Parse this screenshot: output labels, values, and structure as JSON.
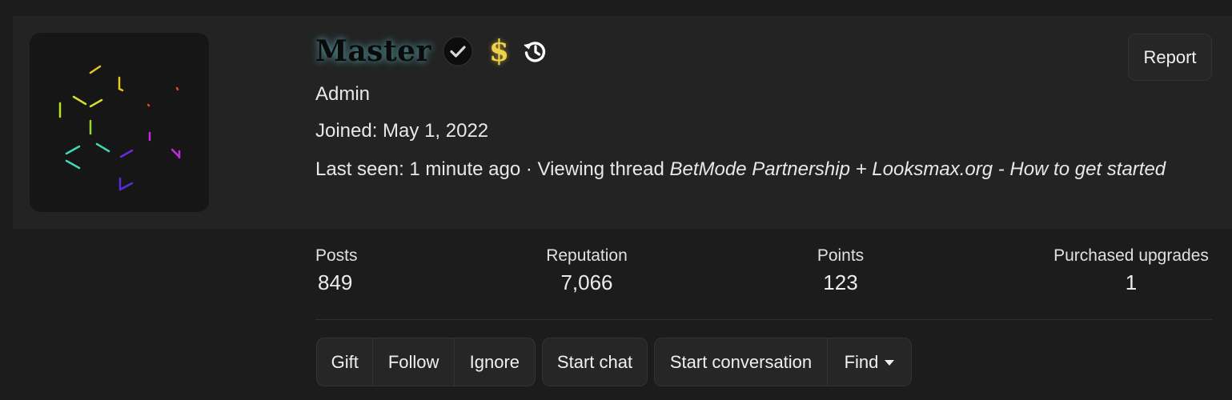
{
  "profile": {
    "username": "Master",
    "title": "Admin",
    "joined": "Joined: May 1, 2022",
    "last_seen_prefix": "Last seen: 1 minute ago · Viewing thread ",
    "last_seen_thread": "BetMode Partnership + Looksmax.org - How to get started",
    "icons": [
      "verified-check-icon",
      "dollar-icon",
      "history-icon"
    ],
    "dollar_glyph": "$",
    "colors": {
      "background": "#1c1c1c",
      "header_bg": "#232323",
      "username_glow": "#78dce6",
      "dollar": "#f0d24a"
    }
  },
  "actions": {
    "report_label": "Report"
  },
  "stats": {
    "posts": {
      "label": "Posts",
      "value": "849"
    },
    "reputation": {
      "label": "Reputation",
      "value": "7,066"
    },
    "points": {
      "label": "Points",
      "value": "123"
    },
    "upgrades": {
      "label": "Purchased upgrades",
      "value": "1"
    }
  },
  "buttons": {
    "gift": "Gift",
    "follow": "Follow",
    "ignore": "Ignore",
    "start_chat": "Start chat",
    "start_conversation": "Start conversation",
    "find": "Find"
  }
}
